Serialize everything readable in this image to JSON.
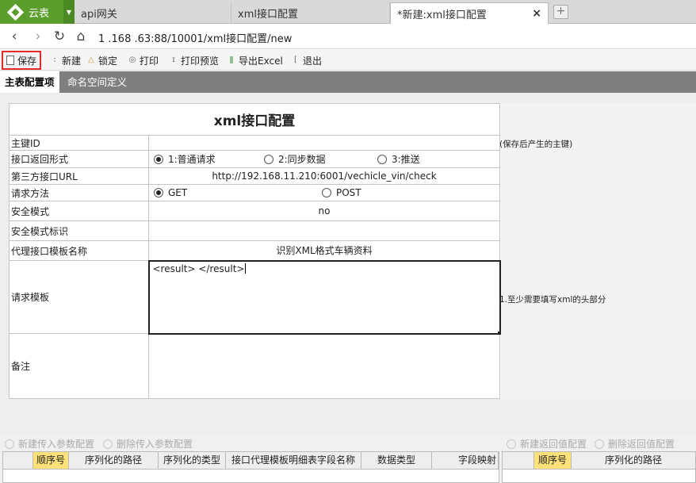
{
  "app": {
    "name": "云表"
  },
  "tabs": [
    {
      "label": "api网关"
    },
    {
      "label": "xml接口配置"
    },
    {
      "label": "*新建:xml接口配置",
      "close": "×"
    }
  ],
  "addressbar": {
    "url": "1_ _ _ _ .63:88/10001/xml接口配置/new",
    "url_visible": "1  .168   .63:88/10001/xml接口配置/new"
  },
  "toolbar": {
    "save": "保存",
    "new": "新建",
    "lock": "锁定",
    "print": "打印",
    "print_preview": "打印预览",
    "export_excel": "导出Excel",
    "exit": "退出"
  },
  "section_tabs": [
    {
      "label": "主表配置项"
    },
    {
      "label": "命名空间定义"
    }
  ],
  "form": {
    "title": "xml接口配置",
    "fields": {
      "primary_key": {
        "label": "主键ID",
        "value": "",
        "note": "(保存后产生的主键)"
      },
      "return_form": {
        "label": "接口返回形式",
        "options": [
          "1:普通请求",
          "2:同步数据",
          "3:推送"
        ],
        "selected": "1:普通请求"
      },
      "third_party_url": {
        "label": "第三方接口URL",
        "value": "http://192.168.11.210:6001/vechicle_vin/check"
      },
      "request_method": {
        "label": "请求方法",
        "options": [
          "GET",
          "POST"
        ],
        "selected": "GET"
      },
      "security_mode": {
        "label": "安全模式",
        "value": "no"
      },
      "security_mode_id": {
        "label": "安全模式标识",
        "value": ""
      },
      "proxy_template_name": {
        "label": "代理接口模板名称",
        "value": "识别XML格式车辆资料"
      },
      "request_template": {
        "label": "请求模板",
        "value": "<result> </result>",
        "note": "1.至少需要填写xml的头部分"
      },
      "remark": {
        "label": "备注",
        "value": ""
      }
    }
  },
  "bottom": {
    "left_actions": {
      "add": "新建传入参数配置",
      "delete": "删除传入参数配置"
    },
    "right_actions": {
      "add": "新建返回值配置",
      "delete": "删除返回值配置"
    },
    "left_columns": [
      "顺序号",
      "序列化的路径",
      "序列化的类型",
      "接口代理模板明细表字段名称",
      "数据类型",
      "字段映射"
    ],
    "right_columns": [
      "顺序号",
      "序列化的路径"
    ]
  },
  "colors": {
    "accent_green": "#5c9e2e",
    "save_border": "#e52a2a",
    "highlight_header": "#ffe17a"
  },
  "icons": [
    "logo-icon",
    "back-icon",
    "forward-icon",
    "refresh-icon",
    "home-icon",
    "new-tab-icon"
  ]
}
